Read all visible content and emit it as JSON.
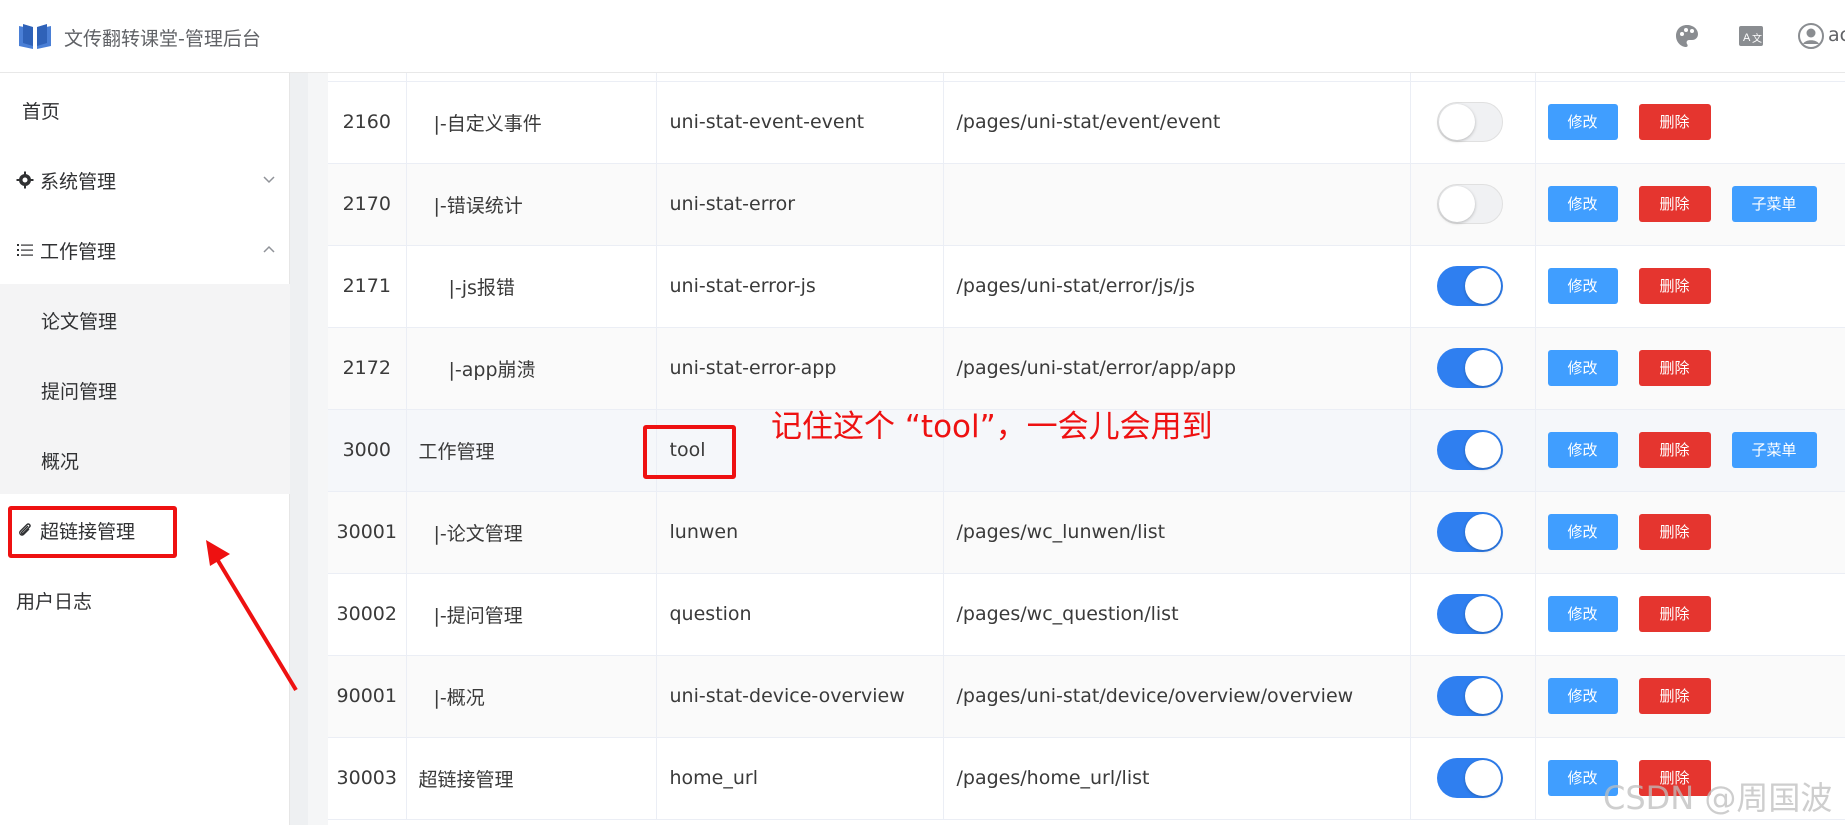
{
  "header": {
    "title": "文传翻转课堂-管理后台",
    "user": "ac",
    "icons": [
      "palette-icon",
      "translate-icon",
      "user-avatar-icon"
    ]
  },
  "sidebar": {
    "items": [
      {
        "label": "首页"
      },
      {
        "label": "系统管理",
        "icon": "gear-icon",
        "expanded": false
      },
      {
        "label": "工作管理",
        "icon": "list-icon",
        "expanded": true
      },
      {
        "label": "论文管理"
      },
      {
        "label": "提问管理"
      },
      {
        "label": "概况"
      },
      {
        "label": "超链接管理",
        "icon": "paperclip-icon",
        "highlighted": true
      },
      {
        "label": "用户日志"
      }
    ]
  },
  "table": {
    "rows": [
      {
        "id": "2160",
        "name": "|-自定义事件",
        "path": "uni-stat-event-event",
        "component": "/pages/uni-stat/event/event",
        "enabled": false,
        "has_sub": false
      },
      {
        "id": "2170",
        "name": "|-错误统计",
        "path": "uni-stat-error",
        "component": "",
        "enabled": false,
        "has_sub": true
      },
      {
        "id": "2171",
        "name": "|-js报错",
        "path": "uni-stat-error-js",
        "component": "/pages/uni-stat/error/js/js",
        "enabled": true,
        "has_sub": false
      },
      {
        "id": "2172",
        "name": "|-app崩溃",
        "path": "uni-stat-error-app",
        "component": "/pages/uni-stat/error/app/app",
        "enabled": true,
        "has_sub": false
      },
      {
        "id": "3000",
        "name": "工作管理",
        "path": "tool",
        "component": "",
        "enabled": true,
        "has_sub": true
      },
      {
        "id": "30001",
        "name": "|-论文管理",
        "path": "lunwen",
        "component": "/pages/wc_lunwen/list",
        "enabled": true,
        "has_sub": false
      },
      {
        "id": "30002",
        "name": "|-提问管理",
        "path": "question",
        "component": "/pages/wc_question/list",
        "enabled": true,
        "has_sub": false
      },
      {
        "id": "90001",
        "name": "|-概况",
        "path": "uni-stat-device-overview",
        "component": "/pages/uni-stat/device/overview/overview",
        "enabled": true,
        "has_sub": false
      },
      {
        "id": "30003",
        "name": "超链接管理",
        "path": "home_url",
        "component": "/pages/home_url/list",
        "enabled": true,
        "has_sub": false
      }
    ],
    "buttons": {
      "edit": "修改",
      "delete": "删除",
      "submenu": "子菜单"
    }
  },
  "annotation": {
    "note": "记住这个 “tool”，一会儿会用到"
  },
  "watermark": "CSDN @周国波",
  "colors": {
    "primary": "#409eff",
    "danger": "#e5352f",
    "switch_on": "#2f7ff0",
    "annotation": "#ee1111"
  }
}
